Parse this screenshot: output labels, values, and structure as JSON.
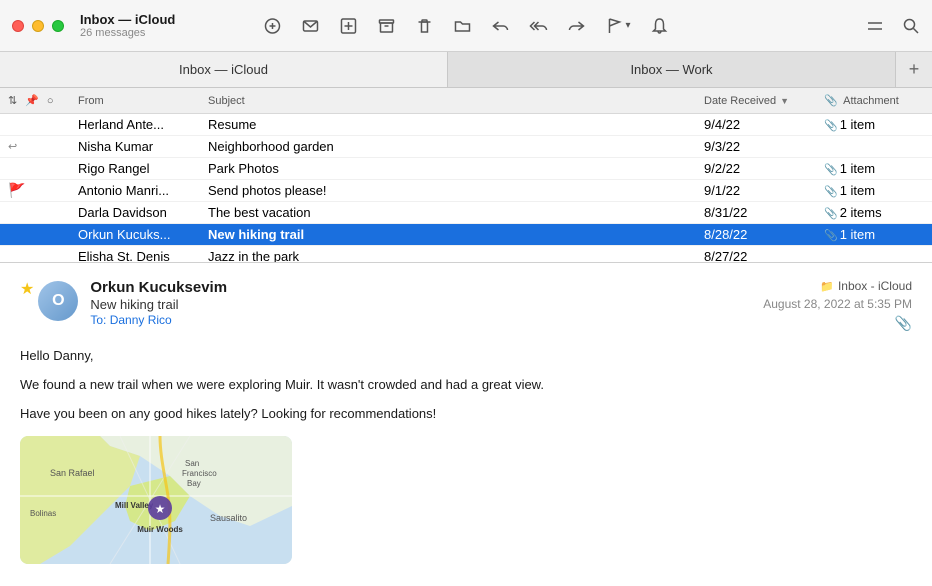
{
  "titlebar": {
    "title": "Inbox — iCloud",
    "subtitle": "26 messages"
  },
  "tabs": [
    {
      "id": "icloud",
      "label": "Inbox — iCloud",
      "active": true
    },
    {
      "id": "work",
      "label": "Inbox — Work",
      "active": false
    }
  ],
  "list_header": {
    "col_from": "From",
    "col_subject": "Subject",
    "col_date": "Date Received",
    "col_attach": "Attachment"
  },
  "emails": [
    {
      "id": 1,
      "flags": "",
      "unread": false,
      "from": "Herland Ante...",
      "subject": "Resume",
      "date": "9/4/22",
      "attachment": "1 item",
      "has_attachment": true,
      "selected": false,
      "flag_color": ""
    },
    {
      "id": 2,
      "flags": "reply",
      "unread": false,
      "from": "Nisha Kumar",
      "subject": "Neighborhood garden",
      "date": "9/3/22",
      "attachment": "",
      "has_attachment": false,
      "selected": false,
      "flag_color": ""
    },
    {
      "id": 3,
      "flags": "",
      "unread": false,
      "from": "Rigo Rangel",
      "subject": "Park Photos",
      "date": "9/2/22",
      "attachment": "1 item",
      "has_attachment": true,
      "selected": false,
      "flag_color": ""
    },
    {
      "id": 4,
      "flags": "flag",
      "unread": false,
      "from": "Antonio Manri...",
      "subject": "Send photos please!",
      "date": "9/1/22",
      "attachment": "1 item",
      "has_attachment": true,
      "selected": false,
      "flag_color": "red"
    },
    {
      "id": 5,
      "flags": "",
      "unread": false,
      "from": "Darla Davidson",
      "subject": "The best vacation",
      "date": "8/31/22",
      "attachment": "2 items",
      "has_attachment": true,
      "selected": false,
      "flag_color": ""
    },
    {
      "id": 6,
      "flags": "",
      "unread": false,
      "from": "Orkun Kucuks...",
      "subject": "New hiking trail",
      "date": "8/28/22",
      "attachment": "1 item",
      "has_attachment": true,
      "selected": true,
      "flag_color": ""
    },
    {
      "id": 7,
      "flags": "",
      "unread": false,
      "from": "Elisha St. Denis",
      "subject": "Jazz in the park",
      "date": "8/27/22",
      "attachment": "",
      "has_attachment": false,
      "selected": false,
      "flag_color": ""
    }
  ],
  "detail": {
    "sender_name": "Orkun Kucuksevim",
    "sender_initial": "O",
    "subject": "New hiking trail",
    "to_label": "To:",
    "to_name": "Danny Rico",
    "inbox": "Inbox - iCloud",
    "date": "August 28, 2022 at 5:35 PM",
    "body_line1": "Hello Danny,",
    "body_line2": "We found a new trail when we were exploring Muir. It wasn't crowded and had a great view.",
    "body_line3": "Have you been on any good hikes lately? Looking for recommendations!"
  }
}
